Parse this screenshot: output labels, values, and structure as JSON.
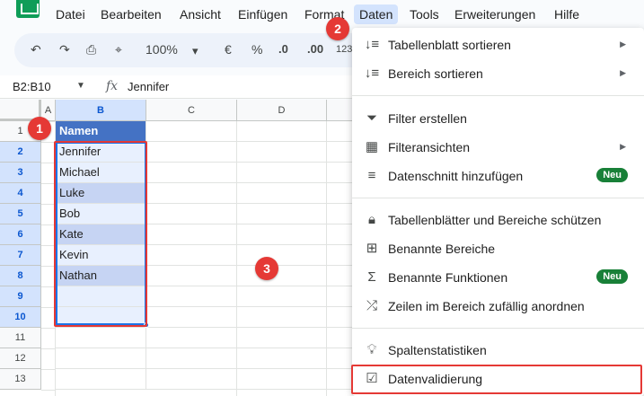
{
  "menu": {
    "items": [
      "Datei",
      "Bearbeiten",
      "Ansicht",
      "Einfügen",
      "Format",
      "Daten",
      "Tools",
      "Erweiterungen",
      "Hilfe"
    ]
  },
  "toolbar": {
    "zoom": "100%",
    "currency": "€",
    "percent": "%",
    "dec_decrease": ".0",
    "dec_increase": ".00",
    "format_more": "123"
  },
  "formula_bar": {
    "range": "B2:B10",
    "fx": "fx",
    "value": "Jennifer"
  },
  "columns": [
    "A",
    "B",
    "C",
    "D"
  ],
  "rows": [
    "1",
    "2",
    "3",
    "4",
    "5",
    "6",
    "7",
    "8",
    "9",
    "10",
    "11",
    "12",
    "13"
  ],
  "cells": {
    "header": "Namen",
    "names": [
      "Jennifer",
      "Michael",
      "Luke",
      "Bob",
      "Kate",
      "Kevin",
      "Nathan"
    ]
  },
  "badges": [
    "1",
    "2",
    "3"
  ],
  "dropdown": {
    "items": [
      {
        "icon": "sort-icon",
        "label": "Tabellenblatt sortieren",
        "submenu": true
      },
      {
        "icon": "sort-icon",
        "label": "Bereich sortieren",
        "submenu": true
      },
      {
        "icon": "filter-icon",
        "label": "Filter erstellen"
      },
      {
        "icon": "filter-views-icon",
        "label": "Filteransichten",
        "submenu": true
      },
      {
        "icon": "slicer-icon",
        "label": "Datenschnitt hinzufügen",
        "badge": "Neu"
      },
      {
        "icon": "lock-icon",
        "label": "Tabellenblätter und Bereiche schützen"
      },
      {
        "icon": "named-ranges-icon",
        "label": "Benannte Bereiche"
      },
      {
        "icon": "sigma-icon",
        "label": "Benannte Funktionen",
        "badge": "Neu"
      },
      {
        "icon": "shuffle-icon",
        "label": "Zeilen im Bereich zufällig anordnen"
      },
      {
        "icon": "lightbulb-icon",
        "label": "Spaltenstatistiken"
      },
      {
        "icon": "data-validation-icon",
        "label": "Datenvalidierung"
      }
    ]
  },
  "colors": {
    "header_blue": "#4472c4",
    "band_light": "#e8f0fe",
    "band_dark": "#c6d4f3",
    "highlight_red": "#e53935",
    "new_badge_green": "#188038"
  }
}
